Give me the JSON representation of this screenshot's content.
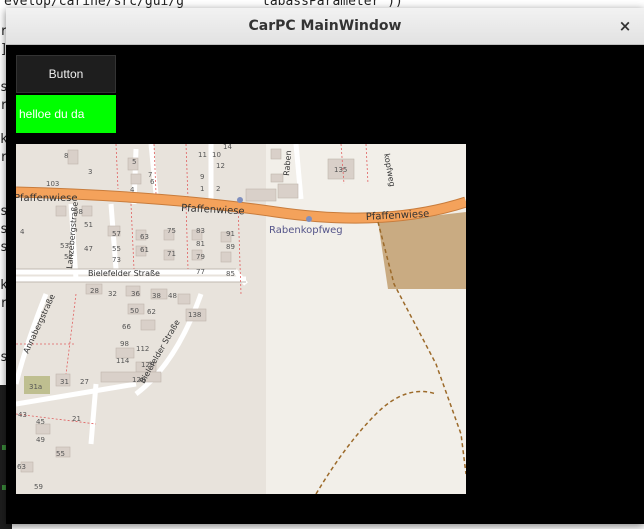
{
  "window": {
    "title": "CarPC MainWindow",
    "close_symbol": "×"
  },
  "controls": {
    "button_label": "Button",
    "label_text": "helloe du da"
  },
  "background_terminal": {
    "top_line": "evelop/carine/src/gui/g",
    "right_line": "tabassParameter ))",
    "side_chars": [
      "r",
      "]",
      "s",
      "r",
      "k",
      "r",
      "s",
      "s",
      "s",
      "k",
      "r",
      "s"
    ]
  },
  "map": {
    "street_labels": [
      "Pfaffenwiese",
      "Pfaffenwiese",
      "Pfaffenwiese",
      "Rabenkopfweg",
      "Bielefelder Straße",
      "Bielefelder Straße",
      "Annabergstraße",
      "Lanzebergstraße",
      "Raben",
      "kopfweg"
    ],
    "house_numbers": [
      "8",
      "11",
      "10",
      "14",
      "12",
      "9",
      "7",
      "5",
      "6",
      "1",
      "2",
      "3",
      "4",
      "103",
      "58",
      "51",
      "57",
      "63",
      "75",
      "83",
      "91",
      "53",
      "47",
      "55",
      "61",
      "71",
      "81",
      "89",
      "52",
      "73",
      "85",
      "77",
      "79",
      "28",
      "32",
      "36",
      "48",
      "38",
      "50",
      "62",
      "66",
      "138",
      "98",
      "112",
      "114",
      "129",
      "128",
      "31",
      "27",
      "31a",
      "21",
      "43",
      "45",
      "49",
      "55",
      "63",
      "59",
      "135",
      "4"
    ],
    "poi_label": "Rabenkopfweg"
  }
}
